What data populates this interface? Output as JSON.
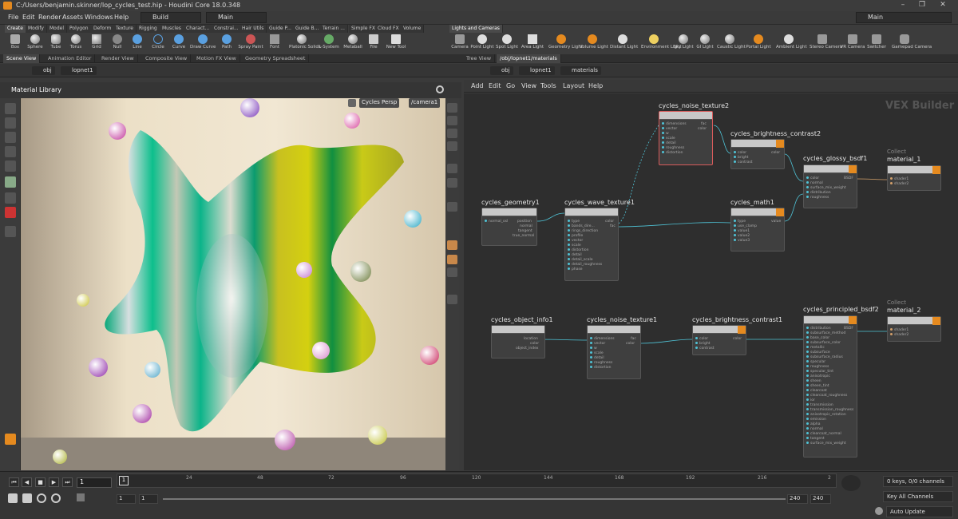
{
  "title_bar": {
    "text": "C:/Users/benjamin.skinner/lop_cycles_test.hip - Houdini Core 18.0.348"
  },
  "menu": [
    "File",
    "Edit",
    "Render",
    "Assets",
    "Windows",
    "Help"
  ],
  "desktop_dropdown": "Build",
  "layout_dropdown": "Main",
  "right_dropdown": "Main",
  "shelf_tabs_left": [
    "Create",
    "Modify",
    "Model",
    "Polygon",
    "Deform",
    "Texture",
    "Rigging",
    "Muscles",
    "Charact...",
    "Constrai...",
    "Hair Utils",
    "Guide P...",
    "Guide B...",
    "Terrain ...",
    "Simple FX",
    "Cloud FX",
    "Volume"
  ],
  "shelf_tools_left": [
    "Box",
    "Sphere",
    "Tube",
    "Torus",
    "Grid",
    "Null",
    "Line",
    "Circle",
    "Curve",
    "Draw Curve",
    "Path",
    "Spray Paint",
    "Font",
    "Platonic Solids",
    "L-System",
    "Metaball",
    "File",
    "New Tool"
  ],
  "shelf_tabs_right": [
    "Lights and Cameras"
  ],
  "shelf_tools_right": [
    "Camera",
    "Point Light",
    "Spot Light",
    "Area Light",
    "Geometry Light",
    "Volume Light",
    "Distant Light",
    "Environment Light",
    "Sky Light",
    "GI Light",
    "Caustic Light",
    "Portal Light",
    "Ambient Light",
    "Stereo Camera",
    "VR Camera",
    "Switcher",
    "Gamepad Camera"
  ],
  "left_pane_tabs": [
    "Scene View",
    "Animation Editor",
    "Render View",
    "Composite View",
    "Motion FX View",
    "Geometry Spreadsheet"
  ],
  "right_pane_tabs": [
    "Tree View",
    "/obj/lopnet1/materials"
  ],
  "left_path": [
    "obj",
    "lopnet1"
  ],
  "right_path": [
    "obj",
    "lopnet1",
    "materials"
  ],
  "viewport": {
    "header": "Material Library",
    "renderer": "Cycles",
    "view": "Persp",
    "camera": "/camera1"
  },
  "network": {
    "menu": [
      "Add",
      "Edit",
      "Go",
      "View",
      "Tools",
      "Layout",
      "Help"
    ],
    "context_label": "VEX Builder",
    "nodes": [
      {
        "name": "cycles_noise_texture2",
        "inputs": [
          "dimensions",
          "vector",
          "w",
          "scale",
          "detail",
          "roughness",
          "distortion"
        ],
        "outputs": [
          "fac",
          "color"
        ]
      },
      {
        "name": "cycles_brightness_contrast2",
        "inputs": [
          "color",
          "bright",
          "contrast"
        ],
        "outputs": [
          "color"
        ]
      },
      {
        "name": "cycles_glossy_bsdf1",
        "inputs": [
          "color",
          "normal",
          "surface_mix_weight",
          "distribution",
          "roughness"
        ],
        "outputs": [
          "BSDF"
        ]
      },
      {
        "name": "material_1",
        "collect": "Collect",
        "inputs": [
          "shader1",
          "shader2"
        ],
        "outputs": []
      },
      {
        "name": "cycles_geometry1",
        "inputs": [
          "normal_osl"
        ],
        "outputs": [
          "position",
          "normal",
          "tangent",
          "true_normal"
        ]
      },
      {
        "name": "cycles_wave_texture1",
        "inputs": [
          "type",
          "bands_dire...",
          "rings_direction",
          "profile",
          "vector",
          "scale",
          "distortion",
          "detail",
          "detail_scale",
          "detail_roughness",
          "phase"
        ],
        "outputs": [
          "color",
          "fac"
        ]
      },
      {
        "name": "cycles_math1",
        "inputs": [
          "type",
          "use_clamp",
          "value1",
          "value2",
          "value3"
        ],
        "outputs": [
          "value"
        ]
      },
      {
        "name": "cycles_object_info1",
        "inputs": [],
        "outputs": [
          "location",
          "color",
          "object_index"
        ]
      },
      {
        "name": "cycles_noise_texture1",
        "inputs": [
          "dimensions",
          "vector",
          "w",
          "scale",
          "detail",
          "roughness",
          "distortion"
        ],
        "outputs": [
          "fac",
          "color"
        ]
      },
      {
        "name": "cycles_brightness_contrast1",
        "inputs": [
          "color",
          "bright",
          "contrast"
        ],
        "outputs": [
          "color"
        ]
      },
      {
        "name": "cycles_principled_bsdf2",
        "inputs": [
          "distribution",
          "subsurface_method",
          "base_color",
          "subsurface_color",
          "metallic",
          "subsurface",
          "subsurface_radius",
          "specular",
          "roughness",
          "specular_tint",
          "anisotropic",
          "sheen",
          "sheen_tint",
          "clearcoat",
          "clearcoat_roughness",
          "ior",
          "transmission",
          "transmission_roughness",
          "anisotropic_rotation",
          "emission",
          "alpha",
          "normal",
          "clearcoat_normal",
          "tangent",
          "surface_mix_weight"
        ],
        "outputs": [
          "BSDF"
        ]
      },
      {
        "name": "material_2",
        "collect": "Collect",
        "inputs": [
          "shader1",
          "shader2"
        ],
        "outputs": []
      }
    ]
  },
  "timeline": {
    "current_frame": "1",
    "ticks": [
      "1",
      "24",
      "48",
      "72",
      "96",
      "120",
      "144",
      "168",
      "192",
      "216",
      "2"
    ],
    "range_start": "1",
    "range_start2": "1",
    "range_end": "240",
    "range_end2": "240",
    "keys_label": "0 keys, 0/0 channels",
    "key_all": "Key All Channels",
    "auto_update": "Auto Update"
  },
  "colors": {
    "accent": "#e58a1f",
    "wire": "#4fc3d6",
    "selected_node": "#d85b5b"
  }
}
